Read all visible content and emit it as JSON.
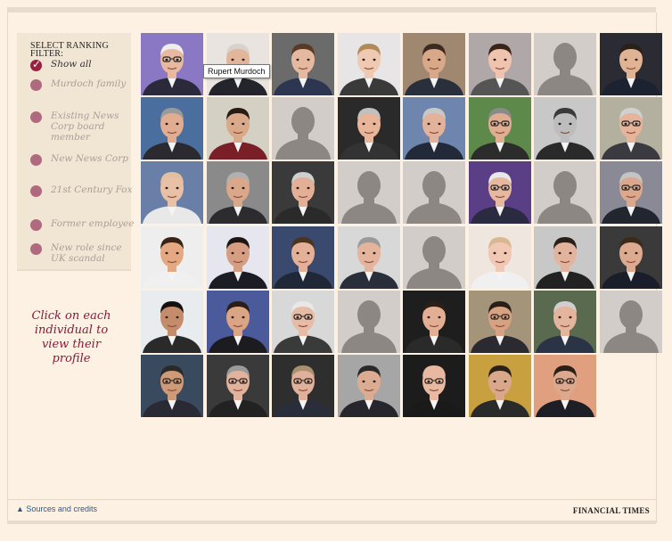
{
  "filter": {
    "title": "SELECT RANKING FILTER:",
    "options": [
      {
        "label": "Show all",
        "active": true
      },
      {
        "label": "Murdoch family",
        "active": false
      },
      {
        "label": "Existing News Corp board member",
        "active": false
      },
      {
        "label": "New News Corp",
        "active": false
      },
      {
        "label": "21st Century Fox",
        "active": false
      },
      {
        "label": "Former employee",
        "active": false
      },
      {
        "label": "New role since UK scandal",
        "active": false
      }
    ]
  },
  "instruction": "Click on each individual to view their profile",
  "tooltip": "Rupert Murdoch",
  "footer": {
    "sources_label": "▲ Sources and credits",
    "brand": "FINANCIAL TIMES"
  },
  "colors": {
    "background": "#fdf1e3",
    "panel": "#f1e5d4",
    "accent": "#9b1f3e",
    "dot": "#b06a7f",
    "link": "#2a5a8c",
    "placeholder_bg": "#d2cdc9",
    "placeholder_figure": "#8d8783"
  },
  "portraits": [
    {
      "type": "photo",
      "bg": "#8b78c4",
      "skin": "#e8b9a0",
      "hair": "#eeeeee",
      "suit": "#2a2a3a",
      "glasses": true
    },
    {
      "type": "photo",
      "bg": "#e9e4e0",
      "skin": "#e3b59a",
      "hair": "#d8d2cc",
      "suit": "#24242c",
      "glasses": false
    },
    {
      "type": "photo",
      "bg": "#6b6b6b",
      "skin": "#e5b9a0",
      "hair": "#5a3a24",
      "suit": "#2d3650",
      "glasses": false
    },
    {
      "type": "photo",
      "bg": "#e7e5e6",
      "skin": "#efc9b2",
      "hair": "#b18a5a",
      "suit": "#3a3a3a",
      "glasses": false
    },
    {
      "type": "photo",
      "bg": "#a08870",
      "skin": "#d8a888",
      "hair": "#3a2a22",
      "suit": "#2a2f3c",
      "glasses": false
    },
    {
      "type": "photo",
      "bg": "#b0a8a8",
      "skin": "#efc3ae",
      "hair": "#3a2418",
      "suit": "#555",
      "glasses": false
    },
    {
      "type": "placeholder"
    },
    {
      "type": "photo",
      "bg": "#2b2b33",
      "skin": "#e0b395",
      "hair": "#2a2018",
      "suit": "#1d2230",
      "glasses": false
    },
    {
      "type": "photo",
      "bg": "#4a6e9e",
      "skin": "#e0ac92",
      "hair": "#9a9a9a",
      "suit": "#2a2a30",
      "glasses": false
    },
    {
      "type": "photo",
      "bg": "#d4d0c4",
      "skin": "#d9a98a",
      "hair": "#2a1a14",
      "suit": "#7a1f28",
      "glasses": false
    },
    {
      "type": "placeholder"
    },
    {
      "type": "photo",
      "bg": "#2a2a2a",
      "skin": "#e8b49a",
      "hair": "#c0c0c0",
      "suit": "#333",
      "glasses": false
    },
    {
      "type": "photo",
      "bg": "#6e86ae",
      "skin": "#e3b29a",
      "hair": "#c8c8c8",
      "suit": "#222a3a",
      "glasses": false
    },
    {
      "type": "photo",
      "bg": "#5d8a4a",
      "skin": "#dfae92",
      "hair": "#8a8a8a",
      "suit": "#2c2c2c",
      "glasses": true
    },
    {
      "type": "photo",
      "bg": "#c8c8c8",
      "skin": "#bdbdbd",
      "hair": "#3a3a3a",
      "suit": "#2a2a2a",
      "glasses": false
    },
    {
      "type": "photo",
      "bg": "#b4b0a0",
      "skin": "#e5b49a",
      "hair": "#d0d0d0",
      "suit": "#3a3a40",
      "glasses": true
    },
    {
      "type": "photo",
      "bg": "#6a7fa8",
      "skin": "#e8c0a6",
      "hair": "#e0c0a0",
      "suit": "#e8e8e8",
      "glasses": false
    },
    {
      "type": "photo",
      "bg": "#8a8a8a",
      "skin": "#d9a78a",
      "hair": "#b0b0b0",
      "suit": "#2b2b30",
      "glasses": false
    },
    {
      "type": "photo",
      "bg": "#3a3a3a",
      "skin": "#e3b097",
      "hair": "#cfcfcf",
      "suit": "#2a2a2a",
      "glasses": false
    },
    {
      "type": "placeholder"
    },
    {
      "type": "placeholder"
    },
    {
      "type": "photo",
      "bg": "#5a3e86",
      "skin": "#e6b8a0",
      "hair": "#e8e8e8",
      "suit": "#2a2a40",
      "glasses": true
    },
    {
      "type": "placeholder"
    },
    {
      "type": "photo",
      "bg": "#8a8a96",
      "skin": "#dba88e",
      "hair": "#c4c4c4",
      "suit": "#22262e",
      "glasses": true
    },
    {
      "type": "photo",
      "bg": "#eeeeee",
      "skin": "#e4a982",
      "hair": "#3a2416",
      "suit": "#f0f0f0",
      "glasses": false
    },
    {
      "type": "photo",
      "bg": "#e6e6ee",
      "skin": "#d59e82",
      "hair": "#1e1612",
      "suit": "#1c1c24",
      "glasses": false
    },
    {
      "type": "photo",
      "bg": "#3a4a6e",
      "skin": "#e4b098",
      "hair": "#4a3422",
      "suit": "#202838",
      "glasses": false
    },
    {
      "type": "photo",
      "bg": "#d8d8d8",
      "skin": "#e4b49c",
      "hair": "#9a9a9a",
      "suit": "#2a2e3a",
      "glasses": false
    },
    {
      "type": "placeholder"
    },
    {
      "type": "photo",
      "bg": "#efe6df",
      "skin": "#f0c8b4",
      "hair": "#d8b890",
      "suit": "#f0f0f0",
      "glasses": false
    },
    {
      "type": "photo",
      "bg": "#c8c8c8",
      "skin": "#e2b49e",
      "hair": "#2a2018",
      "suit": "#222",
      "glasses": false
    },
    {
      "type": "photo",
      "bg": "#3a3a3a",
      "skin": "#dcaa8e",
      "hair": "#3a2a1a",
      "suit": "#1a1e2a",
      "glasses": false
    },
    {
      "type": "photo",
      "bg": "#e9ecef",
      "skin": "#c48c6a",
      "hair": "#141010",
      "suit": "#2a2a2a",
      "glasses": false
    },
    {
      "type": "photo",
      "bg": "#4a5a9a",
      "skin": "#dba484",
      "hair": "#2a1e16",
      "suit": "#1c1c20",
      "glasses": false
    },
    {
      "type": "photo",
      "bg": "#d8d8d8",
      "skin": "#e6bca6",
      "hair": "#e8e8e8",
      "suit": "#3a3a3a",
      "glasses": true
    },
    {
      "type": "placeholder"
    },
    {
      "type": "photo",
      "bg": "#1e1e1e",
      "skin": "#e2ae94",
      "hair": "#2a2018",
      "suit": "#2a2a2a",
      "glasses": false
    },
    {
      "type": "photo",
      "bg": "#a4947a",
      "skin": "#d7a282",
      "hair": "#2a1e16",
      "suit": "#2a2a30",
      "glasses": true
    },
    {
      "type": "photo",
      "bg": "#5a6a4e",
      "skin": "#e4b49c",
      "hair": "#cfcfcf",
      "suit": "#2a3446",
      "glasses": false
    },
    {
      "type": "placeholder"
    },
    {
      "type": "photo",
      "bg": "#3a4a5e",
      "skin": "#cf9a78",
      "hair": "#2a2a2a",
      "suit": "#2a2a34",
      "glasses": true
    },
    {
      "type": "photo",
      "bg": "#3a3a3a",
      "skin": "#e2b29c",
      "hair": "#9a9a9a",
      "suit": "#222",
      "glasses": true
    },
    {
      "type": "photo",
      "bg": "#2e2e2e",
      "skin": "#e0b09a",
      "hair": "#a89070",
      "suit": "#2a2e3a",
      "glasses": true
    },
    {
      "type": "photo",
      "bg": "#a6a6a6",
      "skin": "#dcac92",
      "hair": "#2a2a2a",
      "suit": "#26262c",
      "glasses": false
    },
    {
      "type": "photo",
      "bg": "#1c1c1c",
      "skin": "#e8b8a0",
      "hair": "#e8b8a0",
      "suit": "#1a1a1a",
      "glasses": true
    },
    {
      "type": "photo",
      "bg": "#c8a040",
      "skin": "#d9a88a",
      "hair": "#2a2018",
      "suit": "#2a2a2a",
      "glasses": false
    },
    {
      "type": "photo",
      "bg": "#e0a080",
      "skin": "#dca98e",
      "hair": "#2a2018",
      "suit": "#1e1e26",
      "glasses": true
    }
  ]
}
